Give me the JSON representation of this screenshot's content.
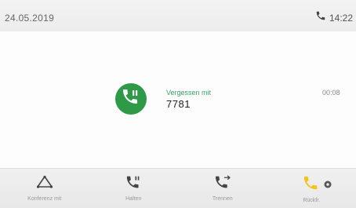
{
  "status": {
    "date": "24.05.2019",
    "time": "14:22",
    "phone_icon": "phone-icon"
  },
  "call": {
    "label": "Vergessen mit",
    "number": "7781",
    "duration": "00:08",
    "avatar_icon": "phone-hold-icon",
    "accent_color": "#2e9a47"
  },
  "softkeys": [
    {
      "label": "Konferenz mit",
      "icon": "conference-icon"
    },
    {
      "label": "Halten",
      "icon": "hold-icon"
    },
    {
      "label": "Trennen",
      "icon": "hangup-icon"
    },
    {
      "label": "Rückfr.",
      "icon": "consult-icon"
    }
  ]
}
